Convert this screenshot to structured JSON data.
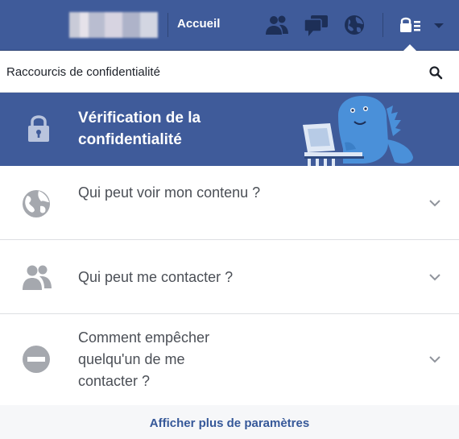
{
  "topbar": {
    "home_label": "Accueil",
    "icons": [
      "friend-requests-icon",
      "messages-icon",
      "notifications-globe-icon",
      "privacy-shortcuts-icon",
      "account-dropdown-chevron-icon"
    ]
  },
  "panel": {
    "title": "Raccourcis de confidentialité",
    "search_icon": "search-icon"
  },
  "banner": {
    "title": "Vérification de la confidentialité",
    "icon": "lock-icon",
    "illustration": "privacy-dinosaur"
  },
  "items": [
    {
      "label": "Qui peut voir mon contenu ?",
      "icon": "globe-icon"
    },
    {
      "label": "Qui peut me contacter ?",
      "icon": "people-icon"
    },
    {
      "label": "Comment empêcher quelqu'un de me contacter ?",
      "icon": "block-icon"
    }
  ],
  "footer": {
    "link": "Afficher plus de paramètres"
  },
  "colors": {
    "brand_blue": "#3f5b9a",
    "link_blue": "#365899",
    "icon_gray": "#90949c",
    "dino_blue": "#4a90d9"
  }
}
